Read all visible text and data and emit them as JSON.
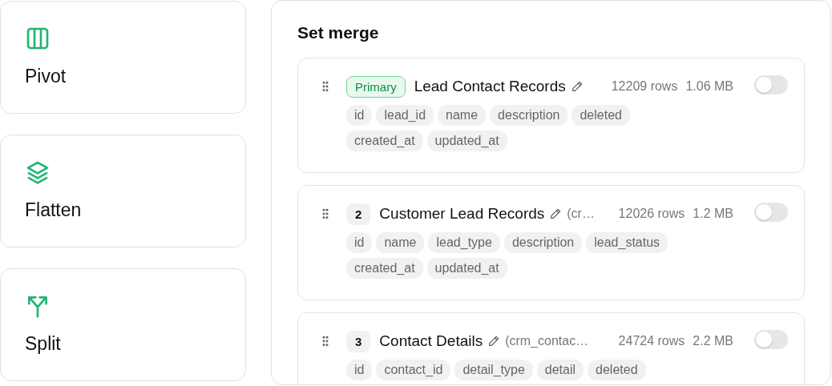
{
  "operations": [
    {
      "kind": "pivot",
      "label": "Pivot"
    },
    {
      "kind": "flatten",
      "label": "Flatten"
    },
    {
      "kind": "split",
      "label": "Split"
    }
  ],
  "panel": {
    "title": "Set merge",
    "tables": [
      {
        "badge": {
          "kind": "primary",
          "text": "Primary"
        },
        "name": "Lead Contact Records",
        "rows": "12209 rows",
        "size": "1.06 MB",
        "on": false,
        "columns": [
          "id",
          "lead_id",
          "name",
          "description",
          "deleted",
          "created_at",
          "updated_at"
        ]
      },
      {
        "badge": {
          "kind": "index",
          "text": "2"
        },
        "name": "Customer Lead Records",
        "source": "(cr…",
        "rows": "12026 rows",
        "size": "1.2 MB",
        "on": false,
        "columns": [
          "id",
          "name",
          "lead_type",
          "description",
          "lead_status",
          "created_at",
          "updated_at"
        ]
      },
      {
        "badge": {
          "kind": "index",
          "text": "3"
        },
        "name": "Contact Details",
        "source": "(crm_contac…",
        "rows": "24724 rows",
        "size": "2.2 MB",
        "on": false,
        "columns": [
          "id",
          "contact_id",
          "detail_type",
          "detail",
          "deleted"
        ]
      }
    ]
  }
}
